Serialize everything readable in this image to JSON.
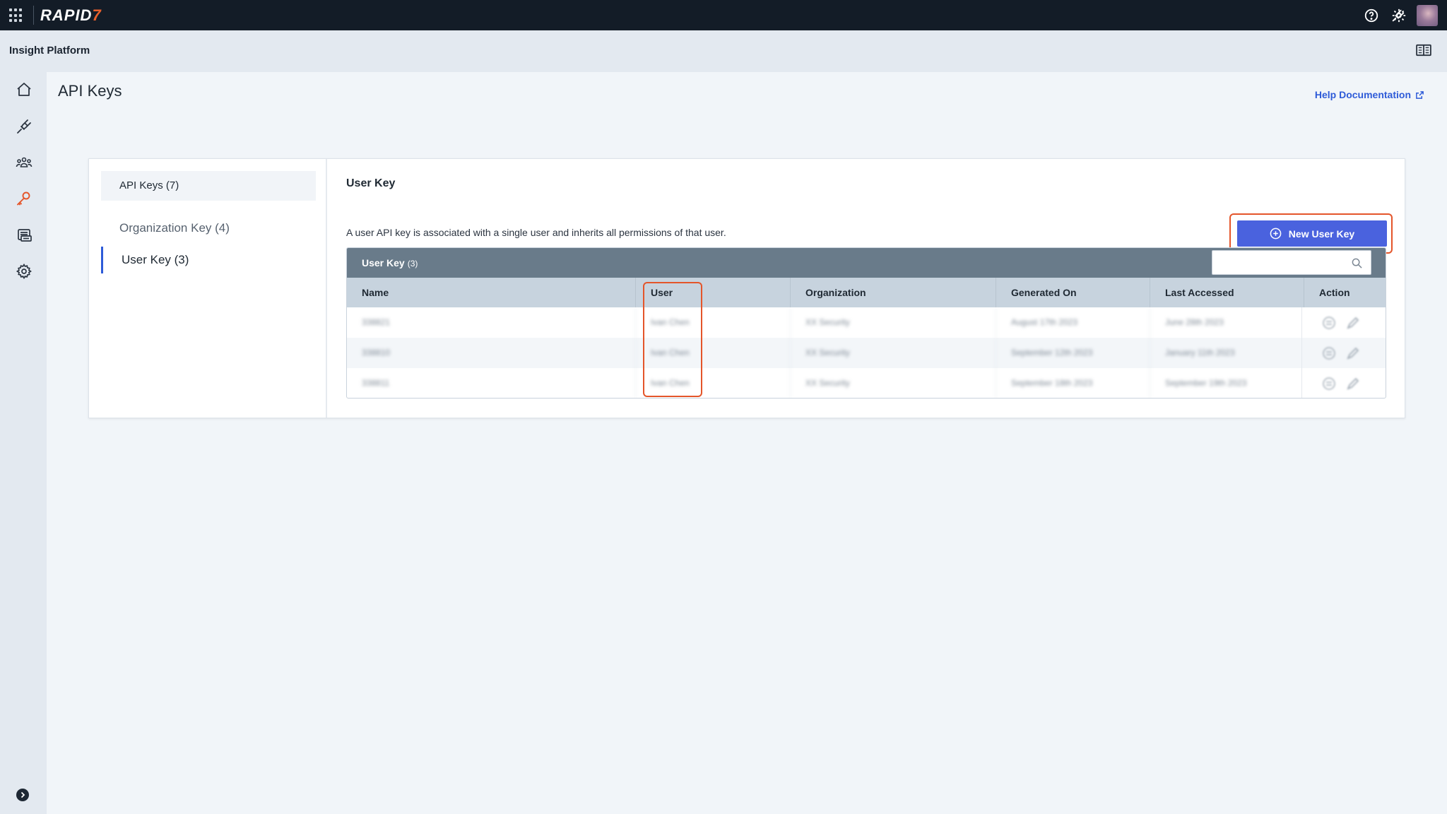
{
  "topbar": {
    "logo_text": "RAPID",
    "logo_accent": "7",
    "icons": [
      "apps-grid-icon",
      "help-icon",
      "plugin-icon",
      "settings-icon",
      "user-avatar"
    ]
  },
  "subheader": {
    "app_title": "Insight Platform"
  },
  "page": {
    "title": "API Keys",
    "help_link": "Help Documentation"
  },
  "side_menu": {
    "header": "API Keys (7)",
    "items": [
      {
        "label": "Organization Key (4)",
        "active": false
      },
      {
        "label": "User Key (3)",
        "active": true
      }
    ]
  },
  "content": {
    "title": "User Key",
    "description": "A user API key is associated with a single user and inherits all permissions of that user.",
    "new_button": "New User Key"
  },
  "table": {
    "title": "User Key",
    "count": "(3)",
    "search_placeholder": "",
    "columns": [
      "Name",
      "User",
      "Organization",
      "Generated On",
      "Last Accessed",
      "Action"
    ],
    "rows": [
      [
        "338821",
        "Ivan Chen",
        "XX Security",
        "August 17th 2023",
        "June 28th 2023"
      ],
      [
        "338810",
        "Ivan Chen",
        "XX Security",
        "September 12th 2023",
        "January 11th 2023"
      ],
      [
        "338811",
        "Ivan Chen",
        "XX Security",
        "September 18th 2023",
        "September 19th 2023"
      ]
    ]
  },
  "colors": {
    "primary": "#4a62de",
    "accent_orange": "#e4552a",
    "topbar_bg": "#131c27",
    "table_header_bg": "#697b8a",
    "link": "#2e5bd8"
  }
}
